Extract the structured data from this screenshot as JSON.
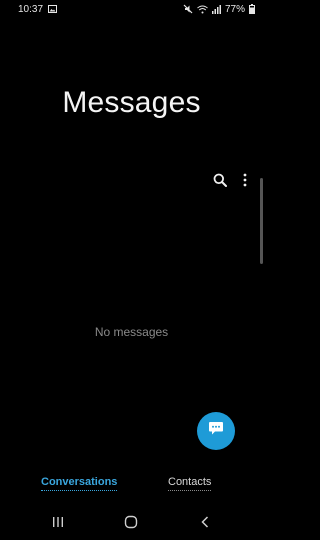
{
  "status_bar": {
    "time": "10:37",
    "battery": "77%",
    "icons": [
      "gallery-icon",
      "mute-icon",
      "wifi-icon",
      "signal-icon",
      "battery-icon"
    ]
  },
  "app": {
    "title": "Messages"
  },
  "toolbar": {
    "icons": [
      "search-icon",
      "more-options-icon"
    ]
  },
  "main": {
    "empty_message": "No messages"
  },
  "fab": {
    "icon": "new-message-icon",
    "color": "#1e9bd7"
  },
  "tabs": [
    {
      "label": "Conversations",
      "selected": true
    },
    {
      "label": "Contacts",
      "selected": false
    }
  ],
  "nav_bar": {
    "icons": [
      "recents-icon",
      "home-icon",
      "back-icon"
    ]
  },
  "colors": {
    "background": "#000000",
    "accent": "#3aa6dd"
  }
}
